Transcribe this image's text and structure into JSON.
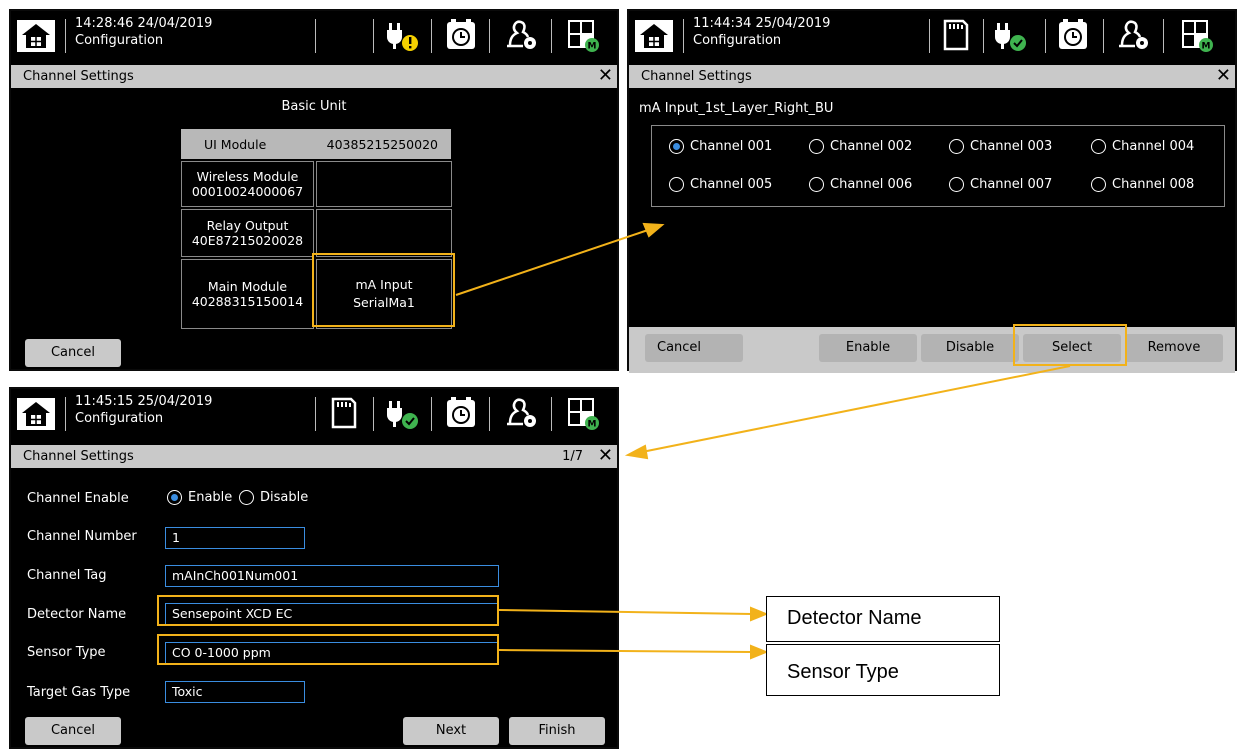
{
  "screen1": {
    "time": "14:28:46 24/04/2019",
    "subtitle": "Configuration",
    "title": "Channel Settings",
    "heading": "Basic Unit",
    "ui_module_label": "UI Module",
    "ui_module_serial": "40385215250020",
    "wireless_label": "Wireless Module",
    "wireless_serial": "00010024000067",
    "relay_label": "Relay Output",
    "relay_serial": "40E87215020028",
    "main_label": "Main Module",
    "main_serial": "40288315150014",
    "ma_label": "mA Input",
    "ma_serial": "SerialMa1",
    "cancel": "Cancel",
    "close": "✕"
  },
  "screen2": {
    "time": "11:44:34  25/04/2019",
    "subtitle": "Configuration",
    "title": "Channel Settings",
    "module_name": "mA Input_1st_Layer_Right_BU",
    "channels": [
      "Channel 001",
      "Channel 002",
      "Channel 003",
      "Channel 004",
      "Channel 005",
      "Channel 006",
      "Channel 007",
      "Channel 008"
    ],
    "selected_channel": "Channel 001",
    "buttons": {
      "cancel": "Cancel",
      "enable": "Enable",
      "disable": "Disable",
      "select": "Select",
      "remove": "Remove"
    },
    "close": "✕"
  },
  "screen3": {
    "time": "11:45:15  25/04/2019",
    "subtitle": "Configuration",
    "title": "Channel Settings",
    "page": "1/7",
    "close": "✕",
    "fields": {
      "channel_enable_label": "Channel Enable",
      "enable_option": "Enable",
      "disable_option": "Disable",
      "channel_number_label": "Channel Number",
      "channel_number_value": "1",
      "channel_tag_label": "Channel Tag",
      "channel_tag_value": "mAInCh001Num001",
      "detector_name_label": "Detector Name",
      "detector_name_value": "Sensepoint XCD EC",
      "sensor_type_label": "Sensor Type",
      "sensor_type_value": "CO 0-1000 ppm",
      "target_gas_label": "Target Gas Type",
      "target_gas_value": "Toxic"
    },
    "buttons": {
      "cancel": "Cancel",
      "next": "Next",
      "finish": "Finish"
    }
  },
  "callouts": {
    "detector_name": "Detector Name",
    "sensor_type": "Sensor Type"
  },
  "colors": {
    "highlight": "#f2b21a",
    "radio_selected": "#3a8de0",
    "status_warning": "#f5d000",
    "status_ok": "#3fb34f"
  },
  "header_icons": [
    "home-icon",
    "power-plug-icon",
    "alarm-clock-icon",
    "user-key-icon",
    "module-grid-icon",
    "sd-card-icon"
  ]
}
